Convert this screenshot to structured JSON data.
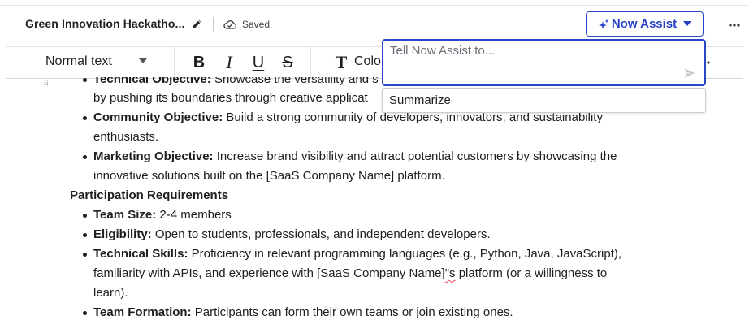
{
  "header": {
    "doc_title": "Green Innovation Hackatho...",
    "save_status": "Saved.",
    "now_assist_label": "Now Assist"
  },
  "toolbar": {
    "text_style": "Normal text",
    "bold": "B",
    "italic": "I",
    "underline": "U",
    "strikethrough": "S",
    "text_color_glyph": "T",
    "text_color_label": "Colo"
  },
  "now_assist": {
    "placeholder": "Tell Now Assist to...",
    "menu_items": [
      "Summarize"
    ]
  },
  "document": {
    "objectives": [
      {
        "label": "Technical Objective:",
        "text": " Showcase the versatility and s",
        "cont": "by pushing its boundaries through creative applicat"
      },
      {
        "label": "Community Objective:",
        "text": " Build a strong community of developers, innovators, and sustainability",
        "cont": "enthusiasts."
      },
      {
        "label": "Marketing Objective:",
        "text": " Increase brand visibility and attract potential customers by showcasing the",
        "cont": "innovative solutions built on the [SaaS Company Name] platform."
      }
    ],
    "section_heading": "Participation Requirements",
    "requirements": [
      {
        "label": "Team Size:",
        "text": " 2-4 members"
      },
      {
        "label": "Eligibility:",
        "text": " Open to students, professionals, and independent developers."
      },
      {
        "label": "Technical Skills:",
        "text": " Proficiency in relevant programming languages (e.g., Python, Java, JavaScript),",
        "cont_pre": "familiarity with APIs, and experience with [SaaS Company Name]",
        "cont_flag": "\"s",
        "cont_post": " platform (or a willingness to",
        "cont2": "learn)."
      },
      {
        "label": "Team Formation:",
        "text": " Participants can form their own teams or join existing ones."
      }
    ]
  },
  "colors": {
    "accent": "#2b47c9",
    "spellcheck": "#e04b63"
  }
}
